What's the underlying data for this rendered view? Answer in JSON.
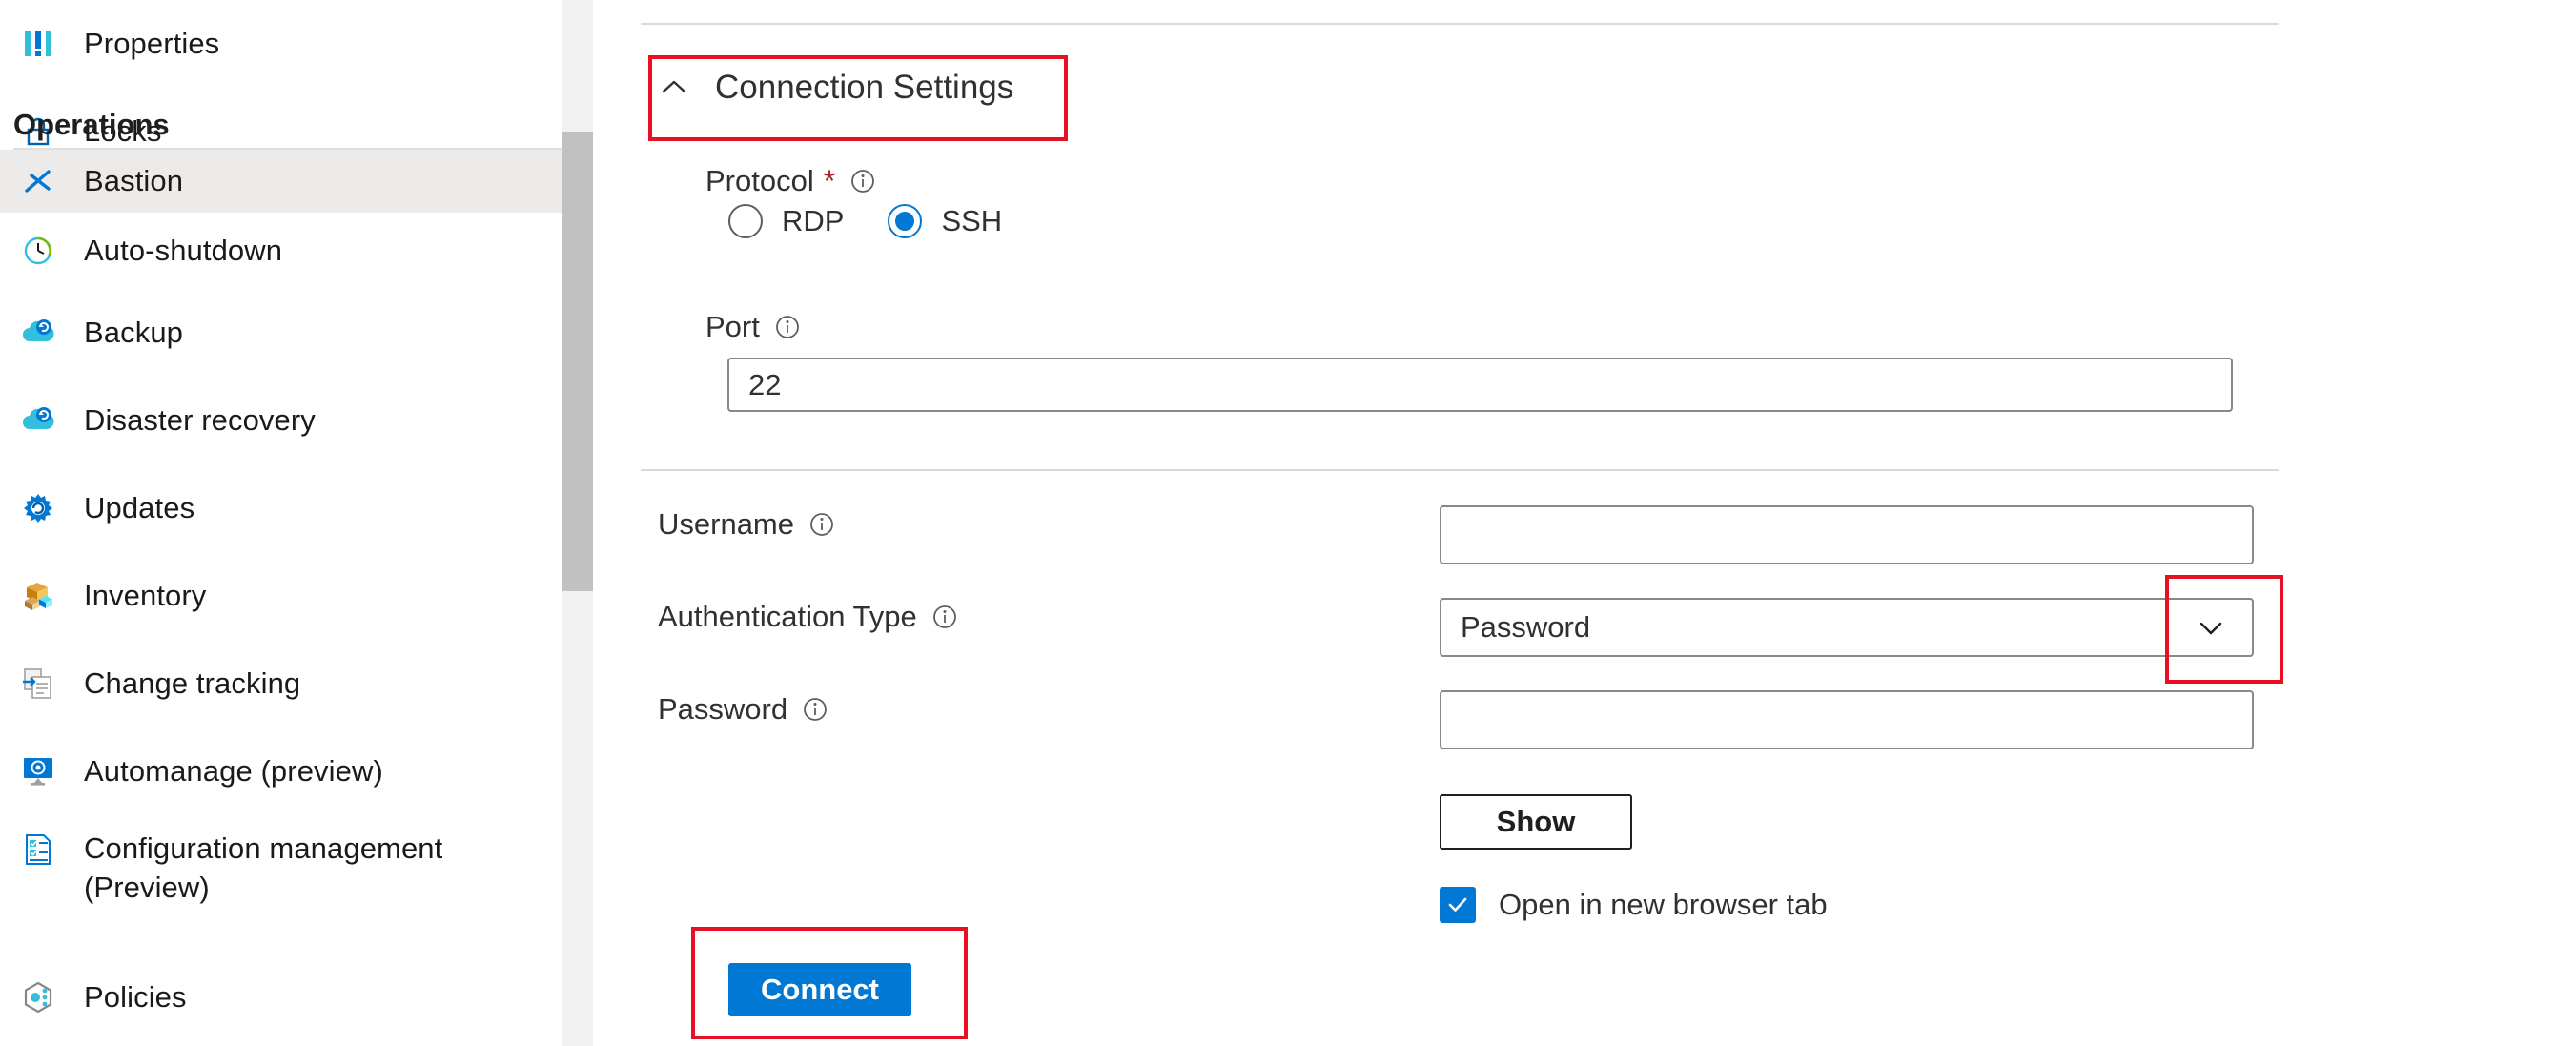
{
  "sidebar": {
    "items": [
      {
        "label": "Properties",
        "icon": "properties-icon",
        "selected": false
      },
      {
        "label": "Locks",
        "icon": "lock-icon",
        "selected": false
      }
    ],
    "group_header": "Operations",
    "operations": [
      {
        "label": "Bastion",
        "icon": "bastion-icon",
        "selected": true
      },
      {
        "label": "Auto-shutdown",
        "icon": "clock-icon",
        "selected": false
      },
      {
        "label": "Backup",
        "icon": "cloud-backup-icon",
        "selected": false
      },
      {
        "label": "Disaster recovery",
        "icon": "cloud-recovery-icon",
        "selected": false
      },
      {
        "label": "Updates",
        "icon": "updates-gear-icon",
        "selected": false
      },
      {
        "label": "Inventory",
        "icon": "inventory-boxes-icon",
        "selected": false
      },
      {
        "label": "Change tracking",
        "icon": "change-tracking-icon",
        "selected": false
      },
      {
        "label": "Automanage (preview)",
        "icon": "automanage-monitor-icon",
        "selected": false
      },
      {
        "label": "Configuration management (Preview)",
        "icon": "configuration-checklist-icon",
        "selected": false
      },
      {
        "label": "Policies",
        "icon": "policies-hexagon-icon",
        "selected": false
      }
    ]
  },
  "main": {
    "section": {
      "title": "Connection Settings",
      "chevron": "chevron-up-icon"
    },
    "protocol": {
      "label": "Protocol",
      "required_marker": "*",
      "info": "info-icon",
      "options": [
        {
          "label": "RDP",
          "checked": false
        },
        {
          "label": "SSH",
          "checked": true
        }
      ]
    },
    "port": {
      "label": "Port",
      "info": "info-icon",
      "value": "22",
      "placeholder": ""
    },
    "username": {
      "label": "Username",
      "info": "info-icon",
      "value": "",
      "placeholder": ""
    },
    "auth_type": {
      "label": "Authentication Type",
      "info": "info-icon",
      "value": "Password",
      "chevron": "chevron-down-icon"
    },
    "password": {
      "label": "Password",
      "info": "info-icon",
      "value": "",
      "placeholder": ""
    },
    "show_button": {
      "label": "Show"
    },
    "open_new_tab": {
      "label": "Open in new browser tab",
      "checked": true
    },
    "connect_button": {
      "label": "Connect"
    }
  },
  "colors": {
    "accent": "#0078d4",
    "highlight_box": "#e81123",
    "selected_row": "#edebe9",
    "border": "#8a8886",
    "required": "#a4262c"
  }
}
